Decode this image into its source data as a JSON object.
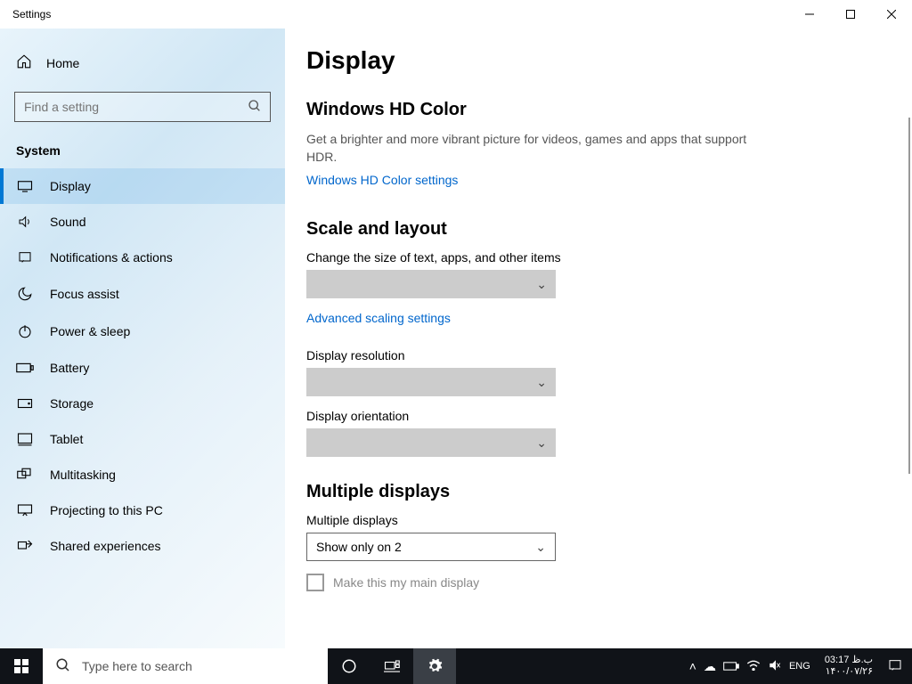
{
  "window": {
    "title": "Settings"
  },
  "sidebar": {
    "home": "Home",
    "search_placeholder": "Find a setting",
    "section": "System",
    "items": [
      {
        "label": "Display"
      },
      {
        "label": "Sound"
      },
      {
        "label": "Notifications & actions"
      },
      {
        "label": "Focus assist"
      },
      {
        "label": "Power & sleep"
      },
      {
        "label": "Battery"
      },
      {
        "label": "Storage"
      },
      {
        "label": "Tablet"
      },
      {
        "label": "Multitasking"
      },
      {
        "label": "Projecting to this PC"
      },
      {
        "label": "Shared experiences"
      }
    ]
  },
  "content": {
    "page_title": "Display",
    "hd_color": {
      "heading": "Windows HD Color",
      "desc": "Get a brighter and more vibrant picture for videos, games and apps that support HDR.",
      "link": "Windows HD Color settings"
    },
    "scale": {
      "heading": "Scale and layout",
      "size_label": "Change the size of text, apps, and other items",
      "advanced_link": "Advanced scaling settings",
      "resolution_label": "Display resolution",
      "orientation_label": "Display orientation"
    },
    "multiple": {
      "heading": "Multiple displays",
      "label": "Multiple displays",
      "value": "Show only on 2",
      "main_display": "Make this my main display"
    }
  },
  "taskbar": {
    "search_placeholder": "Type here to search",
    "lang": "ENG",
    "time": "03:17",
    "ampm": "ب.ظ",
    "date": "۱۴۰۰/۰۷/۲۶"
  }
}
